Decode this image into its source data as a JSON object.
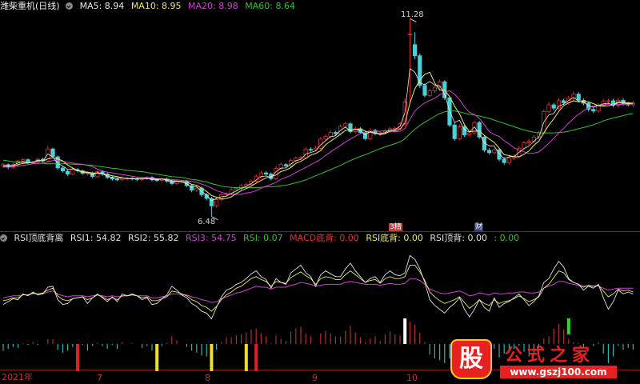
{
  "colors": {
    "up": "#e03030",
    "down": "#4ad0d8",
    "ma5": "#e8e8e8",
    "ma10": "#e8e860",
    "ma20": "#d040d0",
    "ma60": "#30c030",
    "rsi1": "#e0e0e0",
    "rsi2": "#e8e860",
    "rsi3": "#d040d0"
  },
  "header": {
    "stock": "潍柴重机(日线)",
    "ma5": "MA5: 8.94",
    "ma10": "MA10: 8.95",
    "ma20": "MA20: 8.98",
    "ma60": "MA60: 8.64"
  },
  "indicator_header": {
    "name": "RSI顶底背离",
    "rsi1": "RSI1: 54.82",
    "rsi2": "RSI2: 55.82",
    "rsi3": "RSI3: 54.75",
    "rsi": "RSI: 0.07",
    "macd": "MACD底背: 0.00",
    "rsi_bottom": "RSI底背: 0.00",
    "rsi_top": "RSI顶背: 0.00",
    "extra": ": 0.00"
  },
  "annotations": {
    "high": "11.28",
    "low": "6.48"
  },
  "badges": [
    {
      "text": "3精",
      "color": "#c04040"
    },
    {
      "text": "财",
      "color": "#304080"
    }
  ],
  "x_axis": [
    "2021年",
    "7",
    "8",
    "9",
    "10"
  ],
  "logo": {
    "title": "公式之家",
    "url": "www.gszj100.com",
    "glyph": "股"
  },
  "chart_data": [
    {
      "type": "candlestick",
      "title": "潍柴重机(日线)",
      "series_names": [
        "MA5",
        "MA10",
        "MA20",
        "MA60"
      ],
      "close": [
        7.75,
        7.68,
        7.74,
        7.82,
        7.86,
        7.79,
        7.8,
        7.87,
        7.83,
        8.12,
        7.94,
        7.66,
        7.59,
        7.51,
        7.62,
        7.59,
        7.53,
        7.53,
        7.45,
        7.57,
        7.51,
        7.43,
        7.39,
        7.38,
        7.41,
        7.41,
        7.4,
        7.38,
        7.4,
        7.43,
        7.37,
        7.36,
        7.39,
        7.34,
        7.28,
        7.33,
        7.33,
        7.23,
        7.12,
        7.17,
        7.01,
        6.92,
        6.74,
        6.89,
        7.01,
        7.03,
        7.13,
        7.16,
        7.23,
        7.26,
        7.34,
        7.45,
        7.54,
        7.51,
        7.4,
        7.65,
        7.74,
        7.71,
        7.84,
        7.9,
        7.91,
        8.11,
        8.1,
        8.14,
        8.36,
        8.42,
        8.52,
        8.49,
        8.67,
        8.73,
        8.54,
        8.61,
        8.52,
        8.37,
        8.57,
        8.49,
        8.51,
        8.55,
        8.61,
        8.62,
        8.73,
        9.26,
        10.91,
        10.38,
        9.66,
        9.42,
        9.53,
        9.62,
        9.75,
        9.36,
        8.7,
        8.37,
        8.66,
        8.46,
        8.51,
        8.76,
        8.41,
        8.09,
        8.03,
        8.1,
        7.87,
        7.79,
        7.9,
        7.94,
        8.14,
        8.27,
        8.31,
        8.41,
        8.51,
        9.03,
        9.19,
        9.11,
        9.29,
        9.24,
        9.35,
        9.45,
        9.3,
        9.23,
        9.08,
        9.04,
        9.18,
        9.27,
        9.29,
        9.18,
        9.3,
        9.22,
        9.19,
        9.23
      ],
      "open": [
        7.7,
        7.74,
        7.68,
        7.75,
        7.83,
        7.86,
        7.79,
        7.81,
        7.87,
        7.83,
        8.12,
        7.93,
        7.66,
        7.58,
        7.51,
        7.62,
        7.59,
        7.53,
        7.53,
        7.45,
        7.57,
        7.51,
        7.43,
        7.39,
        7.38,
        7.41,
        7.41,
        7.4,
        7.38,
        7.4,
        7.43,
        7.37,
        7.36,
        7.39,
        7.34,
        7.28,
        7.33,
        7.33,
        7.23,
        7.12,
        7.17,
        7.01,
        6.92,
        6.74,
        6.89,
        7.01,
        7.03,
        7.13,
        7.16,
        7.23,
        7.26,
        7.34,
        7.45,
        7.54,
        7.51,
        7.4,
        7.65,
        7.74,
        7.71,
        7.84,
        7.9,
        7.91,
        8.11,
        8.1,
        8.14,
        8.36,
        8.42,
        8.52,
        8.49,
        8.67,
        8.73,
        8.54,
        8.61,
        8.52,
        8.37,
        8.57,
        8.49,
        8.51,
        8.55,
        8.61,
        8.62,
        8.73,
        10.91,
        10.65,
        10.38,
        9.66,
        9.42,
        9.53,
        9.62,
        9.75,
        9.36,
        8.7,
        8.37,
        8.66,
        8.46,
        8.51,
        8.76,
        8.41,
        8.09,
        8.03,
        8.1,
        7.87,
        7.79,
        7.9,
        7.94,
        8.14,
        8.27,
        8.31,
        8.41,
        8.51,
        9.03,
        9.19,
        9.11,
        9.29,
        9.24,
        9.35,
        9.45,
        9.3,
        9.23,
        9.08,
        9.04,
        9.18,
        9.27,
        9.29,
        9.18,
        9.3,
        9.22,
        9.19
      ],
      "high": [
        7.78,
        7.77,
        7.77,
        7.86,
        7.9,
        7.89,
        7.83,
        7.9,
        7.91,
        8.2,
        8.15,
        7.96,
        7.7,
        7.62,
        7.66,
        7.66,
        7.62,
        7.57,
        7.57,
        7.61,
        7.61,
        7.55,
        7.47,
        7.43,
        7.45,
        7.44,
        7.44,
        7.43,
        7.42,
        7.46,
        7.46,
        7.41,
        7.42,
        7.43,
        7.38,
        7.37,
        7.37,
        7.37,
        7.27,
        7.22,
        7.21,
        7.05,
        6.96,
        6.93,
        7.05,
        7.07,
        7.17,
        7.19,
        7.27,
        7.3,
        7.38,
        7.5,
        7.59,
        7.58,
        7.55,
        7.7,
        7.79,
        7.78,
        7.89,
        7.94,
        7.96,
        8.16,
        8.16,
        8.19,
        8.41,
        8.47,
        8.58,
        8.56,
        8.72,
        8.78,
        8.77,
        8.66,
        8.65,
        8.56,
        8.62,
        8.61,
        8.56,
        8.6,
        8.66,
        8.67,
        8.77,
        9.35,
        11.28,
        10.95,
        10.44,
        9.71,
        9.58,
        9.66,
        9.8,
        9.79,
        9.4,
        8.76,
        8.71,
        8.7,
        8.55,
        8.81,
        8.8,
        8.44,
        8.14,
        8.15,
        8.14,
        7.92,
        7.95,
        7.99,
        8.19,
        8.31,
        8.36,
        8.46,
        8.56,
        9.08,
        9.26,
        9.24,
        9.35,
        9.34,
        9.41,
        9.51,
        9.5,
        9.35,
        9.27,
        9.12,
        9.23,
        9.33,
        9.34,
        9.34,
        9.36,
        9.35,
        9.26,
        9.28
      ],
      "low": [
        7.66,
        7.63,
        7.64,
        7.71,
        7.8,
        7.76,
        7.75,
        7.77,
        7.79,
        7.8,
        7.9,
        7.62,
        7.55,
        7.46,
        7.48,
        7.55,
        7.49,
        7.48,
        7.41,
        7.42,
        7.47,
        7.39,
        7.35,
        7.34,
        7.35,
        7.37,
        7.36,
        7.34,
        7.34,
        7.37,
        7.33,
        7.32,
        7.32,
        7.3,
        7.24,
        7.25,
        7.29,
        7.19,
        7.07,
        7.08,
        6.96,
        6.87,
        6.48,
        6.7,
        6.85,
        6.97,
        6.99,
        7.09,
        7.12,
        7.19,
        7.22,
        7.3,
        7.41,
        7.47,
        7.36,
        7.36,
        7.61,
        7.67,
        7.67,
        7.8,
        7.86,
        7.87,
        8.05,
        8.06,
        8.1,
        8.32,
        8.38,
        8.45,
        8.44,
        8.63,
        8.5,
        8.5,
        8.48,
        8.33,
        8.33,
        8.45,
        8.44,
        8.47,
        8.51,
        8.57,
        8.58,
        8.68,
        9.22,
        10.3,
        9.6,
        9.37,
        9.38,
        9.48,
        9.57,
        9.31,
        8.65,
        8.32,
        8.33,
        8.41,
        8.42,
        8.46,
        8.36,
        8.04,
        7.98,
        7.99,
        7.82,
        7.74,
        7.75,
        7.85,
        7.89,
        8.09,
        8.22,
        8.26,
        8.36,
        8.47,
        8.98,
        9.05,
        9.07,
        9.19,
        9.19,
        9.3,
        9.25,
        9.18,
        9.03,
        8.99,
        9.0,
        9.14,
        9.22,
        9.13,
        9.13,
        9.17,
        9.15,
        9.14
      ],
      "ma5": [
        7.7,
        7.71,
        7.71,
        7.74,
        7.77,
        7.78,
        7.8,
        7.83,
        7.83,
        7.88,
        7.91,
        7.88,
        7.83,
        7.73,
        7.66,
        7.6,
        7.57,
        7.56,
        7.54,
        7.53,
        7.52,
        7.5,
        7.47,
        7.45,
        7.42,
        7.4,
        7.4,
        7.4,
        7.4,
        7.4,
        7.4,
        7.39,
        7.39,
        7.38,
        7.35,
        7.34,
        7.33,
        7.32,
        7.26,
        7.24,
        7.17,
        7.09,
        6.99,
        6.95,
        6.91,
        6.92,
        6.96,
        7.04,
        7.11,
        7.16,
        7.22,
        7.29,
        7.36,
        7.42,
        7.45,
        7.49,
        7.57,
        7.61,
        7.67,
        7.77,
        7.82,
        7.89,
        7.97,
        8.01,
        8.08,
        8.22,
        8.31,
        8.39,
        8.48,
        8.57,
        8.58,
        8.59,
        8.61,
        8.55,
        8.52,
        8.51,
        8.47,
        8.49,
        8.55,
        8.56,
        8.6,
        8.75,
        9.23,
        9.58,
        9.79,
        9.93,
        9.98,
        9.72,
        9.55,
        9.54,
        9.39,
        9.16,
        8.97,
        8.71,
        8.54,
        8.55,
        8.56,
        8.45,
        8.36,
        8.28,
        8.14,
        7.98,
        7.96,
        7.93,
        7.93,
        7.99,
        8.07,
        8.21,
        8.31,
        8.51,
        8.7,
        8.85,
        9.03,
        9.17,
        9.24,
        9.29,
        9.26,
        9.28,
        9.26,
        9.22,
        9.17,
        9.16,
        9.17,
        9.19,
        9.24,
        9.25,
        9.24,
        9.23
      ],
      "ma10": [
        7.68,
        7.68,
        7.69,
        7.7,
        7.72,
        7.74,
        7.76,
        7.77,
        7.78,
        7.8,
        7.84,
        7.84,
        7.82,
        7.8,
        7.78,
        7.76,
        7.75,
        7.72,
        7.69,
        7.63,
        7.59,
        7.56,
        7.54,
        7.52,
        7.5,
        7.48,
        7.46,
        7.44,
        7.43,
        7.42,
        7.41,
        7.4,
        7.39,
        7.39,
        7.38,
        7.37,
        7.36,
        7.35,
        7.33,
        7.31,
        7.27,
        7.23,
        7.17,
        7.11,
        7.07,
        7.04,
        7.02,
        7.02,
        7.02,
        7.05,
        7.07,
        7.11,
        7.17,
        7.22,
        7.26,
        7.31,
        7.38,
        7.43,
        7.48,
        7.55,
        7.61,
        7.67,
        7.74,
        7.8,
        7.87,
        7.96,
        8.05,
        8.13,
        8.21,
        8.29,
        8.36,
        8.43,
        8.49,
        8.52,
        8.54,
        8.55,
        8.55,
        8.56,
        8.55,
        8.54,
        8.55,
        8.62,
        8.84,
        9.04,
        9.15,
        9.24,
        9.3,
        9.35,
        9.43,
        9.5,
        9.53,
        9.45,
        9.32,
        9.14,
        9.01,
        8.96,
        8.86,
        8.71,
        8.54,
        8.47,
        8.42,
        8.32,
        8.24,
        8.15,
        8.09,
        8.05,
        8.01,
        8.02,
        8.05,
        8.15,
        8.26,
        8.38,
        8.51,
        8.62,
        8.75,
        8.86,
        8.96,
        9.04,
        9.12,
        9.16,
        9.18,
        9.19,
        9.21,
        9.2,
        9.2,
        9.2,
        9.21,
        9.21
      ],
      "ma20": [
        7.85,
        7.83,
        7.81,
        7.8,
        7.79,
        7.79,
        7.78,
        7.77,
        7.77,
        7.76,
        7.77,
        7.77,
        7.77,
        7.76,
        7.75,
        7.74,
        7.74,
        7.73,
        7.72,
        7.7,
        7.69,
        7.67,
        7.65,
        7.64,
        7.62,
        7.6,
        7.59,
        7.58,
        7.57,
        7.55,
        7.53,
        7.51,
        7.49,
        7.47,
        7.45,
        7.44,
        7.43,
        7.4,
        7.38,
        7.37,
        7.34,
        7.32,
        7.28,
        7.25,
        7.22,
        7.2,
        7.19,
        7.18,
        7.18,
        7.18,
        7.18,
        7.18,
        7.19,
        7.2,
        7.2,
        7.21,
        7.23,
        7.24,
        7.27,
        7.3,
        7.33,
        7.37,
        7.42,
        7.47,
        7.52,
        7.57,
        7.62,
        7.67,
        7.72,
        7.78,
        7.84,
        7.89,
        7.94,
        7.98,
        8.03,
        8.08,
        8.13,
        8.17,
        8.21,
        8.25,
        8.29,
        8.37,
        8.49,
        8.6,
        8.69,
        8.77,
        8.84,
        8.91,
        8.98,
        9.02,
        9.04,
        9.04,
        9.02,
        8.99,
        8.96,
        8.94,
        8.92,
        8.89,
        8.86,
        8.82,
        8.78,
        8.74,
        8.7,
        8.66,
        8.62,
        8.58,
        8.55,
        8.53,
        8.51,
        8.51,
        8.51,
        8.51,
        8.52,
        8.53,
        8.55,
        8.58,
        8.61,
        8.64,
        8.67,
        8.71,
        8.75,
        8.8,
        8.84,
        8.87,
        8.9,
        8.93,
        8.96,
        8.98
      ]
    },
    {
      "type": "line",
      "title": "RSI顶底背离",
      "series_names": [
        "RSI1",
        "RSI2",
        "RSI3"
      ],
      "rsi1": [
        37,
        40,
        43,
        42,
        48,
        46,
        50,
        47,
        48,
        55,
        56,
        42,
        37,
        38,
        43,
        44,
        45,
        38,
        44,
        48,
        44,
        40,
        45,
        40,
        48,
        46,
        48,
        46,
        42,
        44,
        37,
        38,
        43,
        47,
        56,
        52,
        47,
        44,
        38,
        35,
        30,
        28,
        22,
        34,
        45,
        52,
        54,
        58,
        60,
        64,
        69,
        72,
        66,
        63,
        54,
        64,
        60,
        58,
        70,
        74,
        78,
        70,
        66,
        56,
        68,
        72,
        69,
        66,
        66,
        74,
        80,
        72,
        66,
        60,
        64,
        66,
        60,
        68,
        72,
        68,
        67,
        70,
        88,
        84,
        74,
        60,
        42,
        36,
        32,
        28,
        34,
        38,
        44,
        32,
        24,
        32,
        42,
        34,
        30,
        44,
        34,
        38,
        40,
        44,
        48,
        42,
        36,
        40,
        46,
        60,
        64,
        74,
        82,
        76,
        64,
        60,
        58,
        52,
        56,
        54,
        58,
        44,
        32,
        40,
        52,
        48,
        50,
        48
      ],
      "rsi2": [
        41,
        42,
        44,
        44,
        47,
        47,
        49,
        48,
        49,
        52,
        54,
        46,
        42,
        41,
        43,
        44,
        45,
        42,
        44,
        47,
        45,
        42,
        44,
        42,
        46,
        46,
        47,
        46,
        44,
        45,
        41,
        41,
        43,
        45,
        51,
        50,
        48,
        46,
        42,
        40,
        36,
        34,
        30,
        35,
        42,
        47,
        50,
        54,
        56,
        60,
        64,
        66,
        63,
        61,
        56,
        61,
        60,
        59,
        65,
        68,
        71,
        67,
        64,
        58,
        64,
        66,
        65,
        63,
        63,
        68,
        72,
        68,
        64,
        60,
        62,
        63,
        59,
        64,
        66,
        64,
        64,
        66,
        78,
        78,
        71,
        62,
        50,
        45,
        41,
        38,
        40,
        42,
        45,
        39,
        33,
        37,
        42,
        38,
        36,
        42,
        38,
        40,
        41,
        43,
        46,
        43,
        40,
        42,
        45,
        54,
        58,
        65,
        72,
        70,
        63,
        60,
        58,
        55,
        57,
        56,
        57,
        51,
        45,
        48,
        53,
        51,
        52,
        50
      ],
      "rsi3": [
        44,
        45,
        46,
        46,
        47,
        47,
        48,
        48,
        48,
        50,
        51,
        48,
        46,
        45,
        46,
        46,
        46,
        45,
        46,
        47,
        46,
        45,
        46,
        45,
        46,
        46,
        47,
        46,
        46,
        46,
        44,
        44,
        45,
        46,
        48,
        48,
        47,
        47,
        45,
        44,
        42,
        41,
        39,
        40,
        43,
        45,
        47,
        49,
        50,
        52,
        54,
        56,
        55,
        55,
        53,
        55,
        55,
        55,
        57,
        58,
        60,
        59,
        58,
        56,
        57,
        58,
        58,
        58,
        58,
        60,
        61,
        60,
        59,
        58,
        58,
        58,
        57,
        58,
        59,
        58,
        58,
        59,
        64,
        64,
        62,
        58,
        53,
        51,
        49,
        48,
        49,
        50,
        51,
        49,
        46,
        47,
        49,
        48,
        47,
        49,
        48,
        48,
        49,
        49,
        50,
        50,
        49,
        49,
        50,
        54,
        56,
        58,
        61,
        61,
        59,
        58,
        57,
        56,
        56,
        56,
        56,
        54,
        52,
        53,
        54,
        54,
        54,
        54
      ],
      "ylim": [
        0,
        100
      ],
      "signals": {
        "yellow": [
          31,
          42,
          49
        ],
        "red": [
          15,
          51
        ],
        "white": [
          81
        ],
        "green": [
          114
        ]
      }
    }
  ]
}
